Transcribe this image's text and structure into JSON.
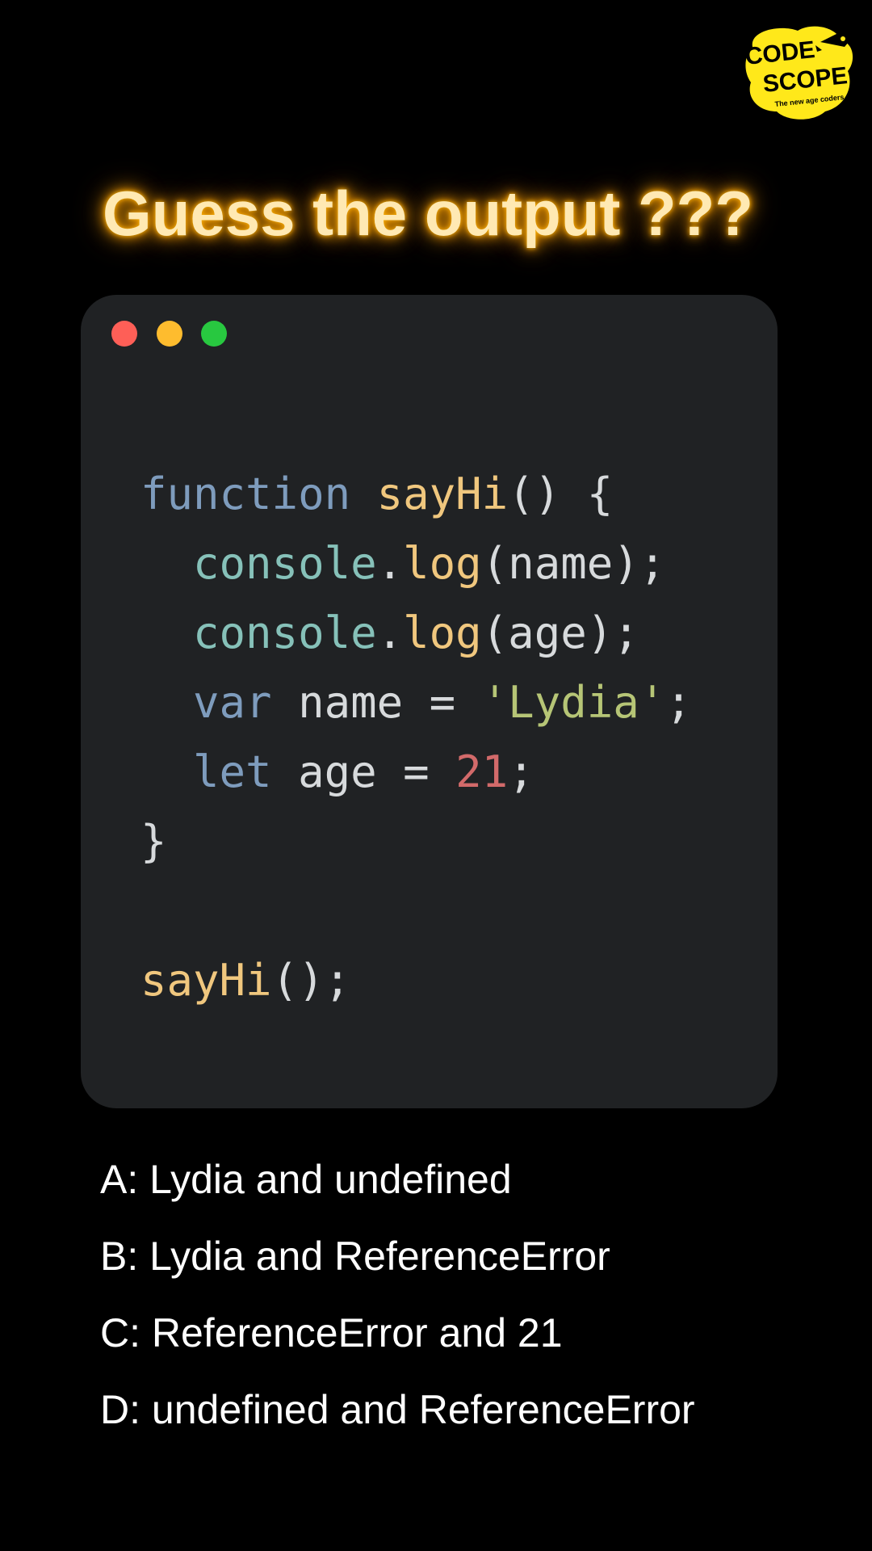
{
  "logo": {
    "line1": "CODE",
    "line2": "SCOPE",
    "tagline": "The new age coders",
    "color": "#ffe81a",
    "icon": "rocket-icon"
  },
  "title": "Guess the output ???",
  "window": {
    "background": "#202224",
    "controls": [
      {
        "name": "close",
        "color": "#fe5f57"
      },
      {
        "name": "minimize",
        "color": "#febc2e"
      },
      {
        "name": "maximize",
        "color": "#28c840"
      }
    ]
  },
  "code": {
    "lines": [
      [
        {
          "t": "function",
          "k": "kw"
        },
        {
          "t": " ",
          "k": "plain"
        },
        {
          "t": "sayHi",
          "k": "fn"
        },
        {
          "t": "() {",
          "k": "plain"
        }
      ],
      [
        {
          "t": "  ",
          "k": "plain"
        },
        {
          "t": "console",
          "k": "obj"
        },
        {
          "t": ".",
          "k": "plain"
        },
        {
          "t": "log",
          "k": "fn"
        },
        {
          "t": "(name);",
          "k": "plain"
        }
      ],
      [
        {
          "t": "  ",
          "k": "plain"
        },
        {
          "t": "console",
          "k": "obj"
        },
        {
          "t": ".",
          "k": "plain"
        },
        {
          "t": "log",
          "k": "fn"
        },
        {
          "t": "(age);",
          "k": "plain"
        }
      ],
      [
        {
          "t": "  ",
          "k": "plain"
        },
        {
          "t": "var",
          "k": "kw"
        },
        {
          "t": " name = ",
          "k": "plain"
        },
        {
          "t": "'Lydia'",
          "k": "str"
        },
        {
          "t": ";",
          "k": "plain"
        }
      ],
      [
        {
          "t": "  ",
          "k": "plain"
        },
        {
          "t": "let",
          "k": "kw"
        },
        {
          "t": " age = ",
          "k": "plain"
        },
        {
          "t": "21",
          "k": "num"
        },
        {
          "t": ";",
          "k": "plain"
        }
      ],
      [
        {
          "t": "}",
          "k": "plain"
        }
      ],
      [],
      [
        {
          "t": "sayHi",
          "k": "fn"
        },
        {
          "t": "();",
          "k": "plain"
        }
      ]
    ]
  },
  "options": [
    "A: Lydia and undefined",
    "B: Lydia and ReferenceError",
    "C: ReferenceError and 21",
    "D: undefined and ReferenceError"
  ]
}
